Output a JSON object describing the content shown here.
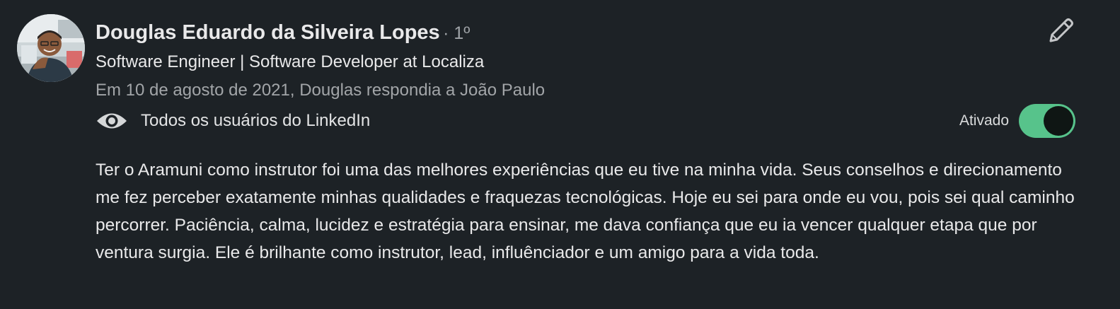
{
  "recommendation": {
    "name": "Douglas Eduardo da Silveira Lopes",
    "degree": "· 1º",
    "headline": "Software Engineer | Software Developer at Localiza",
    "meta": "Em 10 de agosto de 2021, Douglas respondia a João Paulo",
    "visibility_label": "Todos os usuários do LinkedIn",
    "toggle": {
      "label": "Ativado",
      "state": "on",
      "color": "#57c38b"
    },
    "text": "Ter o Aramuni como instrutor foi uma das melhores experiências que eu tive na minha vida. Seus conselhos e direcionamento me fez perceber exatamente minhas qualidades e fraquezas tecnológicas. Hoje eu sei para onde eu vou, pois sei qual caminho percorrer. Paciência, calma, lucidez e estratégia para ensinar, me dava confiança que eu ia vencer qualquer etapa que por ventura surgia. Ele é brilhante como instrutor, lead, influênciador e um amigo para a vida toda.",
    "icons": {
      "visibility": "eye-icon",
      "edit": "pencil-icon"
    }
  }
}
